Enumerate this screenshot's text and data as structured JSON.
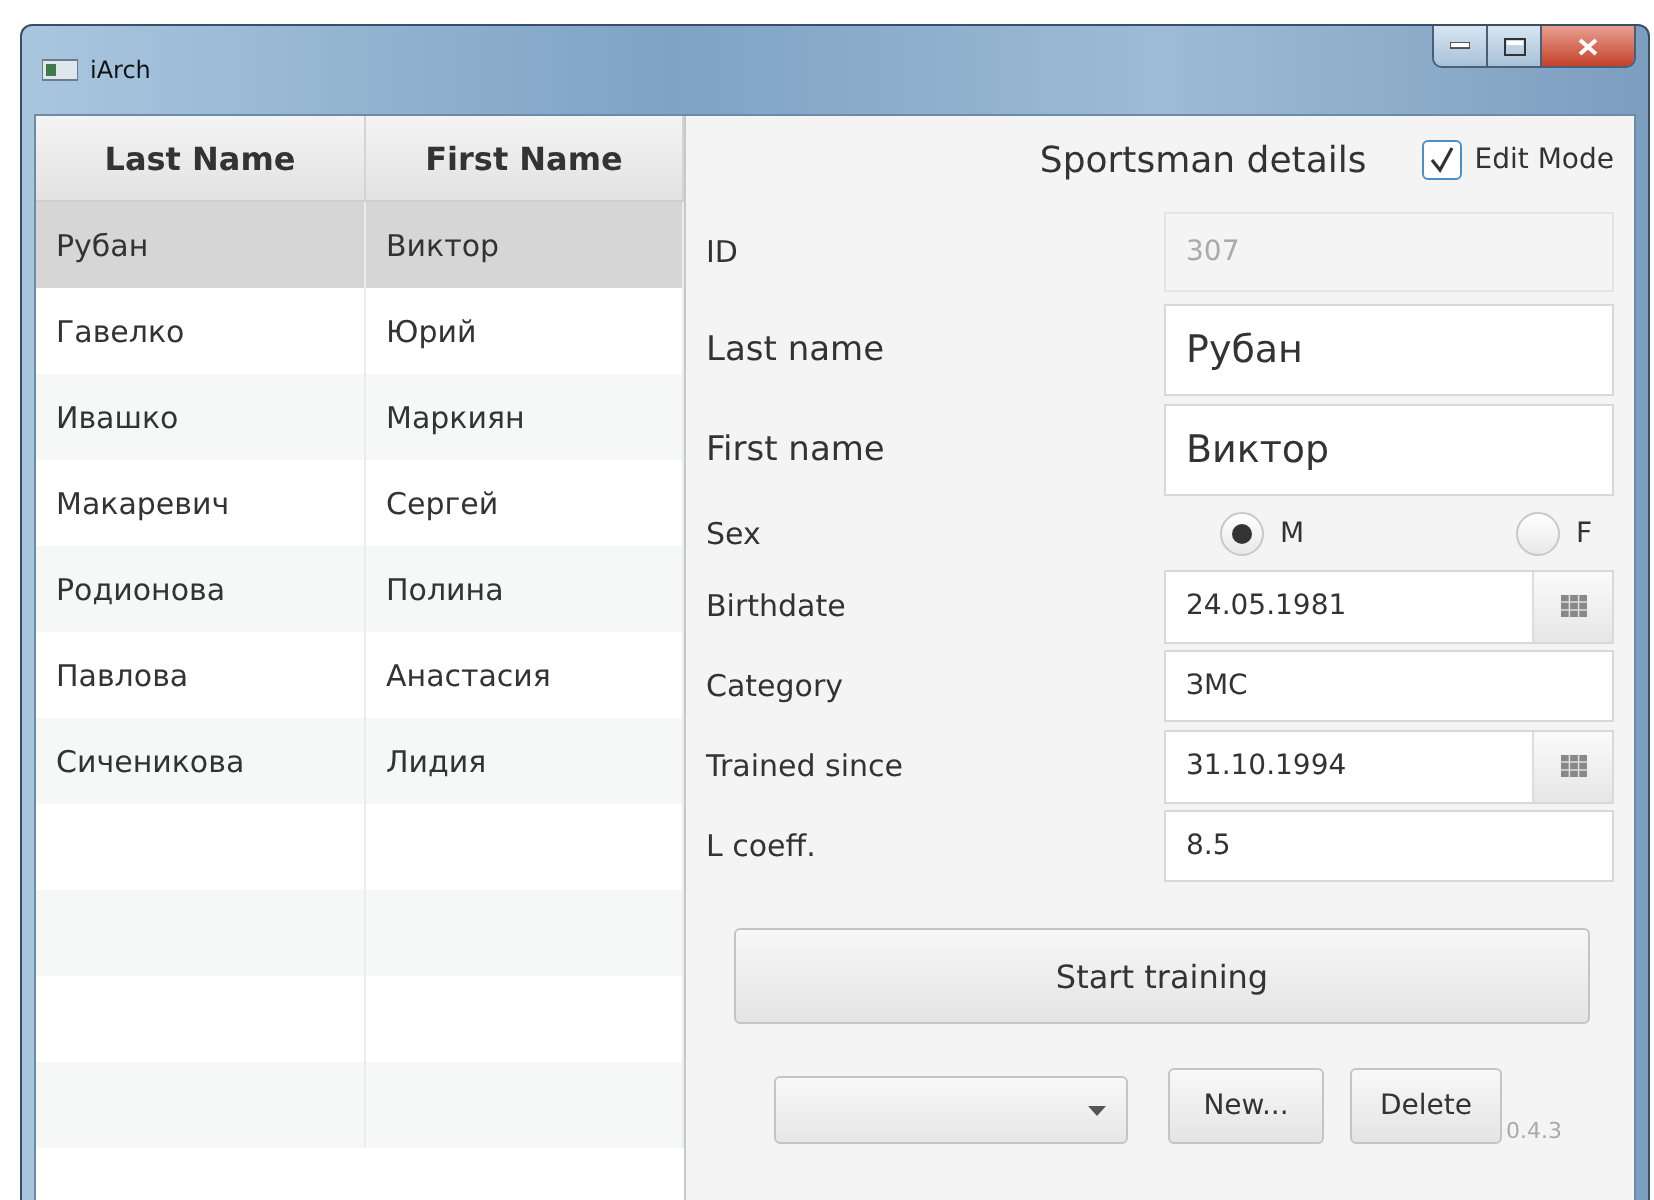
{
  "window": {
    "title": "iArch"
  },
  "table": {
    "columns": [
      "Last Name",
      "First Name"
    ],
    "rows": [
      {
        "cells": [
          "Рубан",
          "Виктор"
        ],
        "selected": true
      },
      {
        "cells": [
          "Гавелко",
          "Юрий"
        ],
        "selected": false
      },
      {
        "cells": [
          "Ивашко",
          "Маркиян"
        ],
        "selected": false
      },
      {
        "cells": [
          "Макаревич",
          "Сергей"
        ],
        "selected": false
      },
      {
        "cells": [
          "Родионова",
          "Полина"
        ],
        "selected": false
      },
      {
        "cells": [
          "Павлова",
          "Анастасия"
        ],
        "selected": false
      },
      {
        "cells": [
          "Сиченикова",
          "Лидия"
        ],
        "selected": false
      }
    ]
  },
  "details": {
    "title": "Sportsman details",
    "edit_mode": {
      "label": "Edit Mode",
      "checked": true
    },
    "fields": [
      {
        "kind": "text",
        "label": "ID",
        "value": "307",
        "disabled": true
      },
      {
        "kind": "big-text",
        "label": "Last name",
        "value": "Рубан",
        "disabled": false
      },
      {
        "kind": "big-text",
        "label": "First name",
        "value": "Виктор",
        "disabled": false
      },
      {
        "kind": "radio",
        "label": "Sex",
        "options": [
          {
            "label": "M",
            "selected": true
          },
          {
            "label": "F",
            "selected": false
          }
        ]
      },
      {
        "kind": "date",
        "label": "Birthdate",
        "value": "24.05.1981",
        "disabled": false
      },
      {
        "kind": "text",
        "label": "Category",
        "value": "ЗМС",
        "disabled": false
      },
      {
        "kind": "date",
        "label": "Trained since",
        "value": "31.10.1994",
        "disabled": false
      },
      {
        "kind": "text",
        "label": "L coeff.",
        "value": "8.5",
        "disabled": false
      }
    ],
    "start_button": "Start training",
    "buttons": [
      "New...",
      "Delete"
    ],
    "version": "0.4.3"
  }
}
